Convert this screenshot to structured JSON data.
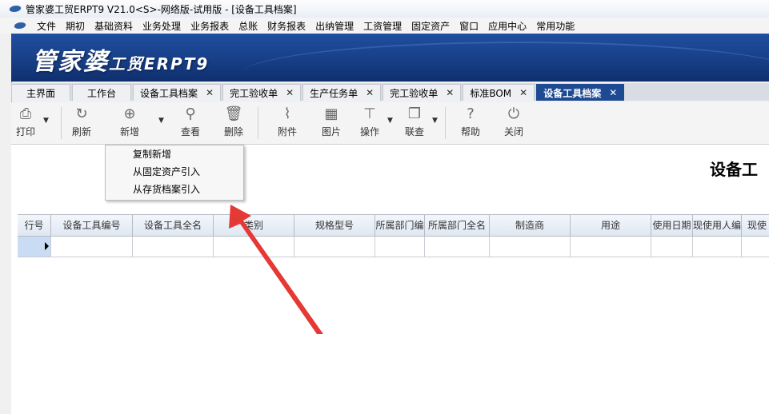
{
  "window": {
    "title": "管家婆工贸ERPT9 V21.0<S>-网络版-试用版 - [设备工具档案]"
  },
  "menu": [
    "文件",
    "期初",
    "基础资料",
    "业务处理",
    "业务报表",
    "总账",
    "财务报表",
    "出纳管理",
    "工资管理",
    "固定资产",
    "窗口",
    "应用中心",
    "常用功能"
  ],
  "banner": {
    "brand": "管家婆",
    "product": "工贸ERPT9"
  },
  "tabs": [
    {
      "label": "主界面",
      "closable": false
    },
    {
      "label": "工作台",
      "closable": false
    },
    {
      "label": "设备工具档案",
      "closable": true
    },
    {
      "label": "完工验收单",
      "closable": true
    },
    {
      "label": "生产任务单",
      "closable": true
    },
    {
      "label": "完工验收单",
      "closable": true
    },
    {
      "label": "标准BOM",
      "closable": true
    },
    {
      "label": "设备工具档案",
      "closable": true,
      "active": true
    }
  ],
  "close_glyph": "✕",
  "toolbar": {
    "print": "打印",
    "refresh": "刷新",
    "add": "新增",
    "view": "查看",
    "delete": "删除",
    "attach": "附件",
    "picture": "图片",
    "operate": "操作",
    "linked": "联查",
    "help": "帮助",
    "close": "关闭"
  },
  "dropdown": {
    "items": [
      "复制新增",
      "从固定资产引入",
      "从存货档案引入"
    ]
  },
  "document": {
    "title": "设备工"
  },
  "grid": {
    "columns": [
      "行号",
      "设备工具编号",
      "设备工具全名",
      "类别",
      "规格型号",
      "所属部门编",
      "所属部门全名",
      "制造商",
      "用途",
      "使用日期",
      "现使用人编",
      "现使"
    ]
  }
}
